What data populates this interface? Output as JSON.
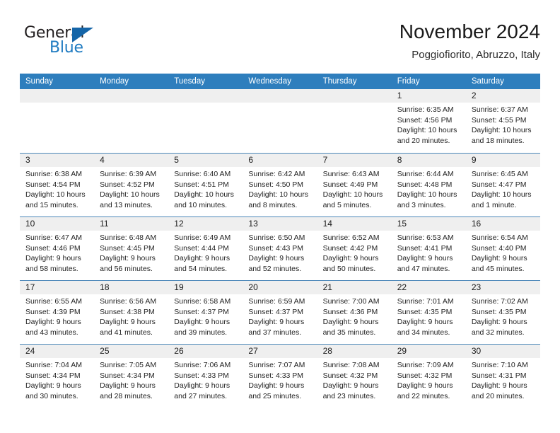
{
  "brand": {
    "name_part1": "General",
    "name_part2": "Blue",
    "triangle_icon": "logo-triangle-icon",
    "accent_color": "#1f7bc1",
    "triangle_color": "#1565a8"
  },
  "header": {
    "title": "November 2024",
    "subtitle": "Poggiofiorito, Abruzzo, Italy"
  },
  "calendar": {
    "header_bg": "#2e7ebd",
    "date_band_bg": "#efefef",
    "weekdays": [
      "Sunday",
      "Monday",
      "Tuesday",
      "Wednesday",
      "Thursday",
      "Friday",
      "Saturday"
    ],
    "weeks": [
      [
        {
          "date": "",
          "empty": true,
          "lines": []
        },
        {
          "date": "",
          "empty": true,
          "lines": []
        },
        {
          "date": "",
          "empty": true,
          "lines": []
        },
        {
          "date": "",
          "empty": true,
          "lines": []
        },
        {
          "date": "",
          "empty": true,
          "lines": []
        },
        {
          "date": "1",
          "empty": false,
          "lines": [
            "Sunrise: 6:35 AM",
            "Sunset: 4:56 PM",
            "Daylight: 10 hours",
            "and 20 minutes."
          ]
        },
        {
          "date": "2",
          "empty": false,
          "lines": [
            "Sunrise: 6:37 AM",
            "Sunset: 4:55 PM",
            "Daylight: 10 hours",
            "and 18 minutes."
          ]
        }
      ],
      [
        {
          "date": "3",
          "empty": false,
          "lines": [
            "Sunrise: 6:38 AM",
            "Sunset: 4:54 PM",
            "Daylight: 10 hours",
            "and 15 minutes."
          ]
        },
        {
          "date": "4",
          "empty": false,
          "lines": [
            "Sunrise: 6:39 AM",
            "Sunset: 4:52 PM",
            "Daylight: 10 hours",
            "and 13 minutes."
          ]
        },
        {
          "date": "5",
          "empty": false,
          "lines": [
            "Sunrise: 6:40 AM",
            "Sunset: 4:51 PM",
            "Daylight: 10 hours",
            "and 10 minutes."
          ]
        },
        {
          "date": "6",
          "empty": false,
          "lines": [
            "Sunrise: 6:42 AM",
            "Sunset: 4:50 PM",
            "Daylight: 10 hours",
            "and 8 minutes."
          ]
        },
        {
          "date": "7",
          "empty": false,
          "lines": [
            "Sunrise: 6:43 AM",
            "Sunset: 4:49 PM",
            "Daylight: 10 hours",
            "and 5 minutes."
          ]
        },
        {
          "date": "8",
          "empty": false,
          "lines": [
            "Sunrise: 6:44 AM",
            "Sunset: 4:48 PM",
            "Daylight: 10 hours",
            "and 3 minutes."
          ]
        },
        {
          "date": "9",
          "empty": false,
          "lines": [
            "Sunrise: 6:45 AM",
            "Sunset: 4:47 PM",
            "Daylight: 10 hours",
            "and 1 minute."
          ]
        }
      ],
      [
        {
          "date": "10",
          "empty": false,
          "lines": [
            "Sunrise: 6:47 AM",
            "Sunset: 4:46 PM",
            "Daylight: 9 hours",
            "and 58 minutes."
          ]
        },
        {
          "date": "11",
          "empty": false,
          "lines": [
            "Sunrise: 6:48 AM",
            "Sunset: 4:45 PM",
            "Daylight: 9 hours",
            "and 56 minutes."
          ]
        },
        {
          "date": "12",
          "empty": false,
          "lines": [
            "Sunrise: 6:49 AM",
            "Sunset: 4:44 PM",
            "Daylight: 9 hours",
            "and 54 minutes."
          ]
        },
        {
          "date": "13",
          "empty": false,
          "lines": [
            "Sunrise: 6:50 AM",
            "Sunset: 4:43 PM",
            "Daylight: 9 hours",
            "and 52 minutes."
          ]
        },
        {
          "date": "14",
          "empty": false,
          "lines": [
            "Sunrise: 6:52 AM",
            "Sunset: 4:42 PM",
            "Daylight: 9 hours",
            "and 50 minutes."
          ]
        },
        {
          "date": "15",
          "empty": false,
          "lines": [
            "Sunrise: 6:53 AM",
            "Sunset: 4:41 PM",
            "Daylight: 9 hours",
            "and 47 minutes."
          ]
        },
        {
          "date": "16",
          "empty": false,
          "lines": [
            "Sunrise: 6:54 AM",
            "Sunset: 4:40 PM",
            "Daylight: 9 hours",
            "and 45 minutes."
          ]
        }
      ],
      [
        {
          "date": "17",
          "empty": false,
          "lines": [
            "Sunrise: 6:55 AM",
            "Sunset: 4:39 PM",
            "Daylight: 9 hours",
            "and 43 minutes."
          ]
        },
        {
          "date": "18",
          "empty": false,
          "lines": [
            "Sunrise: 6:56 AM",
            "Sunset: 4:38 PM",
            "Daylight: 9 hours",
            "and 41 minutes."
          ]
        },
        {
          "date": "19",
          "empty": false,
          "lines": [
            "Sunrise: 6:58 AM",
            "Sunset: 4:37 PM",
            "Daylight: 9 hours",
            "and 39 minutes."
          ]
        },
        {
          "date": "20",
          "empty": false,
          "lines": [
            "Sunrise: 6:59 AM",
            "Sunset: 4:37 PM",
            "Daylight: 9 hours",
            "and 37 minutes."
          ]
        },
        {
          "date": "21",
          "empty": false,
          "lines": [
            "Sunrise: 7:00 AM",
            "Sunset: 4:36 PM",
            "Daylight: 9 hours",
            "and 35 minutes."
          ]
        },
        {
          "date": "22",
          "empty": false,
          "lines": [
            "Sunrise: 7:01 AM",
            "Sunset: 4:35 PM",
            "Daylight: 9 hours",
            "and 34 minutes."
          ]
        },
        {
          "date": "23",
          "empty": false,
          "lines": [
            "Sunrise: 7:02 AM",
            "Sunset: 4:35 PM",
            "Daylight: 9 hours",
            "and 32 minutes."
          ]
        }
      ],
      [
        {
          "date": "24",
          "empty": false,
          "lines": [
            "Sunrise: 7:04 AM",
            "Sunset: 4:34 PM",
            "Daylight: 9 hours",
            "and 30 minutes."
          ]
        },
        {
          "date": "25",
          "empty": false,
          "lines": [
            "Sunrise: 7:05 AM",
            "Sunset: 4:34 PM",
            "Daylight: 9 hours",
            "and 28 minutes."
          ]
        },
        {
          "date": "26",
          "empty": false,
          "lines": [
            "Sunrise: 7:06 AM",
            "Sunset: 4:33 PM",
            "Daylight: 9 hours",
            "and 27 minutes."
          ]
        },
        {
          "date": "27",
          "empty": false,
          "lines": [
            "Sunrise: 7:07 AM",
            "Sunset: 4:33 PM",
            "Daylight: 9 hours",
            "and 25 minutes."
          ]
        },
        {
          "date": "28",
          "empty": false,
          "lines": [
            "Sunrise: 7:08 AM",
            "Sunset: 4:32 PM",
            "Daylight: 9 hours",
            "and 23 minutes."
          ]
        },
        {
          "date": "29",
          "empty": false,
          "lines": [
            "Sunrise: 7:09 AM",
            "Sunset: 4:32 PM",
            "Daylight: 9 hours",
            "and 22 minutes."
          ]
        },
        {
          "date": "30",
          "empty": false,
          "lines": [
            "Sunrise: 7:10 AM",
            "Sunset: 4:31 PM",
            "Daylight: 9 hours",
            "and 20 minutes."
          ]
        }
      ]
    ]
  }
}
